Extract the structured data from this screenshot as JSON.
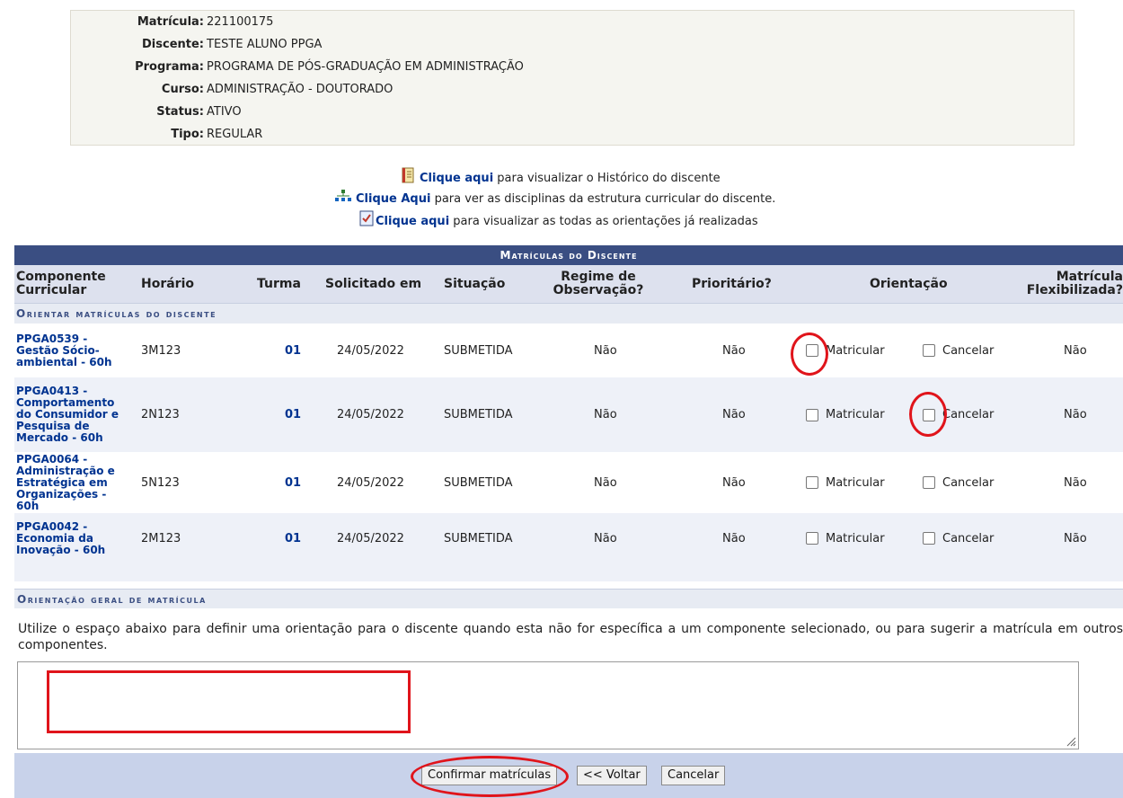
{
  "student": {
    "fields": [
      {
        "label": "Matrícula:",
        "value": "221100175"
      },
      {
        "label": "Discente:",
        "value": "TESTE ALUNO PPGA"
      },
      {
        "label": "Programa:",
        "value": "PROGRAMA DE PÓS-GRADUAÇÃO EM ADMINISTRAÇÃO"
      },
      {
        "label": "Curso:",
        "value": "ADMINISTRAÇÃO - DOUTORADO"
      },
      {
        "label": "Status:",
        "value": "ATIVO"
      },
      {
        "label": "Tipo:",
        "value": "REGULAR"
      }
    ]
  },
  "links": [
    {
      "icon": "history-document-icon",
      "link_text": "Clique aqui",
      "rest": "para visualizar o Histórico do discente"
    },
    {
      "icon": "curriculum-tree-icon",
      "link_text": "Clique Aqui",
      "rest": "para ver as disciplinas da estrutura curricular do discente."
    },
    {
      "icon": "orientations-checklist-icon",
      "link_text": "Clique aqui",
      "rest": "para visualizar as todas as orientações já realizadas"
    }
  ],
  "table": {
    "caption": "Matrículas do Discente",
    "headers": {
      "componente": "Componente Curricular",
      "horario": "Horário",
      "turma": "Turma",
      "solicitado": "Solicitado em",
      "situacao": "Situação",
      "regime": "Regime de Observação?",
      "prioritario": "Prioritário?",
      "orientacao": "Orientação",
      "flexibilizada": "Matrícula Flexibilizada?"
    },
    "section_title": "Orientar matrículas do discente",
    "option_matricular": "Matricular",
    "option_cancelar": "Cancelar",
    "rows": [
      {
        "componente": "PPGA0539 - Gestão Sócio-ambiental - 60h",
        "horario": "3M123",
        "turma": "01",
        "solicitado": "24/05/2022",
        "situacao": "SUBMETIDA",
        "regime": "Não",
        "prioritario": "Não",
        "matricular_checked": false,
        "cancelar_checked": false,
        "flexibilizada": "Não"
      },
      {
        "componente": "PPGA0413 - Comportamento do Consumidor e Pesquisa de Mercado - 60h",
        "horario": "2N123",
        "turma": "01",
        "solicitado": "24/05/2022",
        "situacao": "SUBMETIDA",
        "regime": "Não",
        "prioritario": "Não",
        "matricular_checked": false,
        "cancelar_checked": false,
        "flexibilizada": "Não"
      },
      {
        "componente": "PPGA0064 - Administração e Estratégica em Organizações - 60h",
        "horario": "5N123",
        "turma": "01",
        "solicitado": "24/05/2022",
        "situacao": "SUBMETIDA",
        "regime": "Não",
        "prioritario": "Não",
        "matricular_checked": false,
        "cancelar_checked": false,
        "flexibilizada": "Não"
      },
      {
        "componente": "PPGA0042 - Economia da Inovação - 60h",
        "horario": "2M123",
        "turma": "01",
        "solicitado": "24/05/2022",
        "situacao": "SUBMETIDA",
        "regime": "Não",
        "prioritario": "Não",
        "matricular_checked": false,
        "cancelar_checked": false,
        "flexibilizada": "Não"
      }
    ]
  },
  "general": {
    "title": "Orientação geral de matrícula",
    "instructions": "Utilize o espaço abaixo para definir uma orientação para o discente quando esta não for específica a um componente selecionado, ou para sugerir a matrícula em outros componentes.",
    "textarea_value": ""
  },
  "buttons": {
    "confirm": "Confirmar matrículas",
    "back": "<< Voltar",
    "cancel": "Cancelar"
  },
  "colors": {
    "header_bar": "#3a4e82",
    "link": "#003390",
    "annotation": "#e0141b"
  }
}
